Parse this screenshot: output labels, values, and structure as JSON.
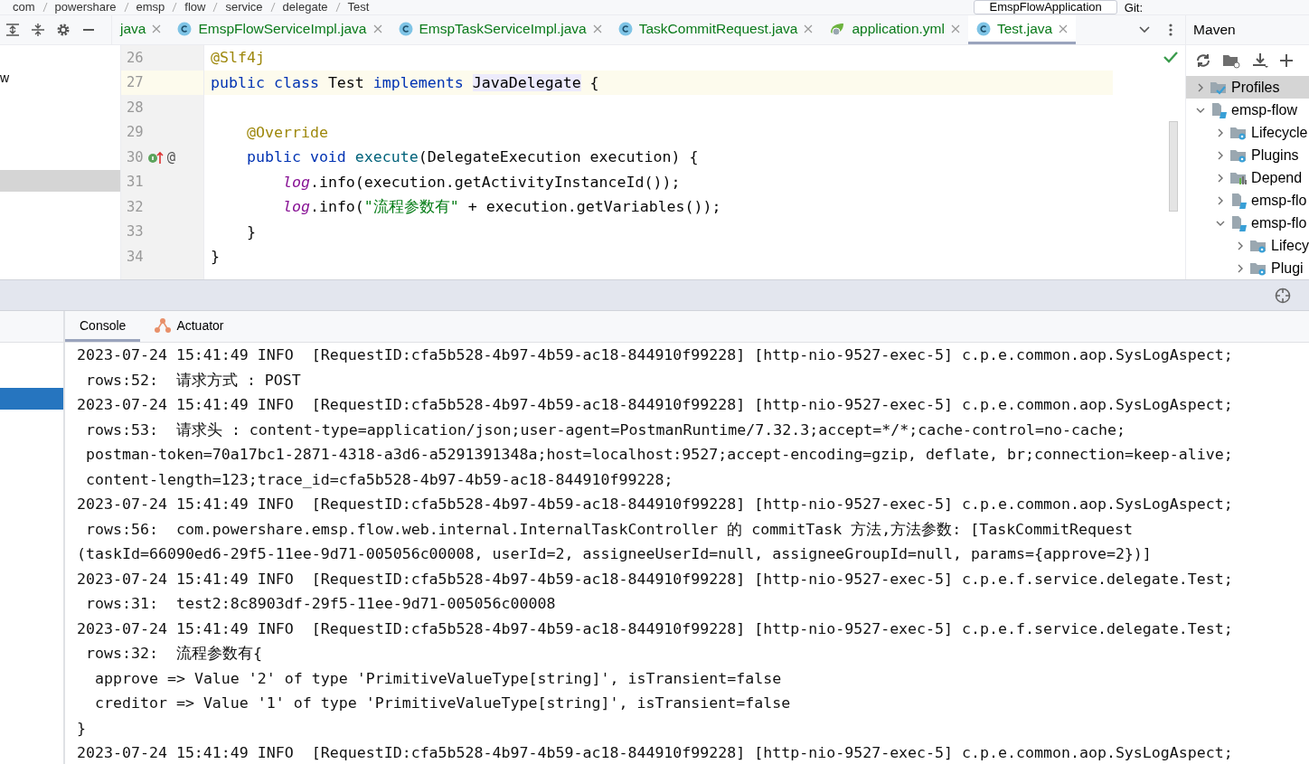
{
  "breadcrumb": [
    "com",
    "powershare",
    "emsp",
    "flow",
    "service",
    "delegate",
    "Test"
  ],
  "toolbar": {
    "run_config": "EmspFlowApplication",
    "vcs_label": "Git:"
  },
  "editor_tabs": [
    {
      "label": "java",
      "kind": "java",
      "selected": false
    },
    {
      "label": "EmspFlowServiceImpl.java",
      "kind": "class",
      "selected": false
    },
    {
      "label": "EmspTaskServiceImpl.java",
      "kind": "class",
      "selected": false
    },
    {
      "label": "TaskCommitRequest.java",
      "kind": "class",
      "selected": false
    },
    {
      "label": "application.yml",
      "kind": "yaml",
      "selected": false
    },
    {
      "label": "Test.java",
      "kind": "class",
      "selected": true
    }
  ],
  "project_panel": {
    "items": [
      {
        "label": "w",
        "selected": false
      },
      {
        "selected": true
      }
    ]
  },
  "code": [
    {
      "number": "26",
      "current": false,
      "tokens": [
        {
          "kind": "ann",
          "text": "@Slf4j"
        }
      ]
    },
    {
      "number": "27",
      "current": true,
      "tokens": [
        {
          "kind": "kw",
          "text": "public class "
        },
        {
          "kind": "plain",
          "text": "Test "
        },
        {
          "kind": "kw",
          "text": "implements "
        },
        {
          "kind": "mark",
          "text": "JavaDelegate"
        },
        {
          "kind": "plain",
          "text": " {"
        }
      ]
    },
    {
      "number": "28",
      "current": false
    },
    {
      "number": "29",
      "current": false,
      "tokens": [
        {
          "kind": "ann",
          "text": "    @Override"
        }
      ]
    },
    {
      "number": "30",
      "current": false,
      "gutter": "@",
      "tokens": [
        {
          "kind": "kw",
          "text": "    public void "
        },
        {
          "kind": "fn",
          "text": "execute"
        },
        {
          "kind": "plain",
          "text": "(DelegateExecution execution) {"
        }
      ]
    },
    {
      "number": "31",
      "current": false,
      "tokens": [
        {
          "kind": "field",
          "text": "        log"
        },
        {
          "kind": "plain",
          "text": ".info(execution.getActivityInstanceId());"
        }
      ]
    },
    {
      "number": "32",
      "current": false,
      "tokens": [
        {
          "kind": "field",
          "text": "        log"
        },
        {
          "kind": "plain",
          "text": ".info("
        },
        {
          "kind": "str",
          "text": "\"流程参数有\""
        },
        {
          "kind": "plain",
          "text": " + execution.getVariables());"
        }
      ]
    },
    {
      "number": "33",
      "current": false,
      "tokens": [
        {
          "kind": "plain",
          "text": "    }"
        }
      ]
    },
    {
      "number": "34",
      "current": false,
      "tokens": [
        {
          "kind": "plain",
          "text": "}"
        }
      ]
    }
  ],
  "maven": {
    "title": "Maven",
    "tree": [
      {
        "label": "Profiles",
        "kind": "profiles",
        "expanded": false,
        "selected": true
      },
      {
        "label": "emsp-flow",
        "kind": "module",
        "expanded": true,
        "selected": false,
        "children": [
          {
            "label": "Lifecycle",
            "kind": "folder",
            "expanded": false,
            "selected": false
          },
          {
            "label": "Plugins",
            "kind": "folder",
            "expanded": false,
            "selected": false
          },
          {
            "label": "Depend",
            "kind": "deps",
            "expanded": false,
            "selected": false
          },
          {
            "label": "emsp-flo",
            "kind": "module",
            "expanded": false,
            "selected": false
          },
          {
            "label": "emsp-flo",
            "kind": "module",
            "expanded": true,
            "selected": false,
            "children": [
              {
                "label": "Lifecy",
                "kind": "folder",
                "expanded": false,
                "selected": false
              },
              {
                "label": "Plugi",
                "kind": "folder",
                "expanded": false,
                "selected": false
              }
            ]
          }
        ]
      }
    ]
  },
  "console_tabs": [
    {
      "label": "Console",
      "selected": true
    },
    {
      "label": "Actuator",
      "selected": false
    }
  ],
  "console_side": [
    {
      "selected": true
    }
  ],
  "console": [
    {
      "kind": "log",
      "text": "2023-07-24 15:41:49 INFO  [RequestID:cfa5b528-4b97-4b59-ac18-844910f99228] [http-nio-9527-exec-5] c.p.e.common.aop.SysLogAspect;"
    },
    {
      "kind": "cont",
      "text": "rows:52:  请求方式 : POST"
    },
    {
      "kind": "log",
      "text": "2023-07-24 15:41:49 INFO  [RequestID:cfa5b528-4b97-4b59-ac18-844910f99228] [http-nio-9527-exec-5] c.p.e.common.aop.SysLogAspect;"
    },
    {
      "kind": "cont",
      "text": "rows:53:  请求头 : content-type=application/json;user-agent=PostmanRuntime/7.32.3;accept=*/*;cache-control=no-cache;"
    },
    {
      "kind": "cont",
      "text": "postman-token=70a17bc1-2871-4318-a3d6-a5291391348a;host=localhost:9527;accept-encoding=gzip, deflate, br;connection=keep-alive;"
    },
    {
      "kind": "cont",
      "text": "content-length=123;trace_id=cfa5b528-4b97-4b59-ac18-844910f99228;"
    },
    {
      "kind": "log",
      "text": "2023-07-24 15:41:49 INFO  [RequestID:cfa5b528-4b97-4b59-ac18-844910f99228] [http-nio-9527-exec-5] c.p.e.common.aop.SysLogAspect;"
    },
    {
      "kind": "cont",
      "text": "rows:56:  com.powershare.emsp.flow.web.internal.InternalTaskController 的 commitTask 方法,方法参数: [TaskCommitRequest"
    },
    {
      "kind": "log",
      "text": "(taskId=66090ed6-29f5-11ee-9d71-005056c00008, userId=2, assigneeUserId=null, assigneeGroupId=null, params={approve=2})]"
    },
    {
      "kind": "log",
      "text": "2023-07-24 15:41:49 INFO  [RequestID:cfa5b528-4b97-4b59-ac18-844910f99228] [http-nio-9527-exec-5] c.p.e.f.service.delegate.Test;"
    },
    {
      "kind": "cont",
      "text": "rows:31:  test2:8c8903df-29f5-11ee-9d71-005056c00008"
    },
    {
      "kind": "log",
      "text": "2023-07-24 15:41:49 INFO  [RequestID:cfa5b528-4b97-4b59-ac18-844910f99228] [http-nio-9527-exec-5] c.p.e.f.service.delegate.Test;"
    },
    {
      "kind": "cont",
      "text": "rows:32:  流程参数有{"
    },
    {
      "kind": "nested",
      "text": "approve => Value '2' of type 'PrimitiveValueType[string]', isTransient=false"
    },
    {
      "kind": "nested",
      "text": "creditor => Value '1' of type 'PrimitiveValueType[string]', isTransient=false"
    },
    {
      "kind": "log",
      "text": "}"
    },
    {
      "kind": "log",
      "text": "2023-07-24 15:41:49 INFO  [RequestID:cfa5b528-4b97-4b59-ac18-844910f99228] [http-nio-9527-exec-5] c.p.e.common.aop.SysLogAspect;"
    }
  ]
}
